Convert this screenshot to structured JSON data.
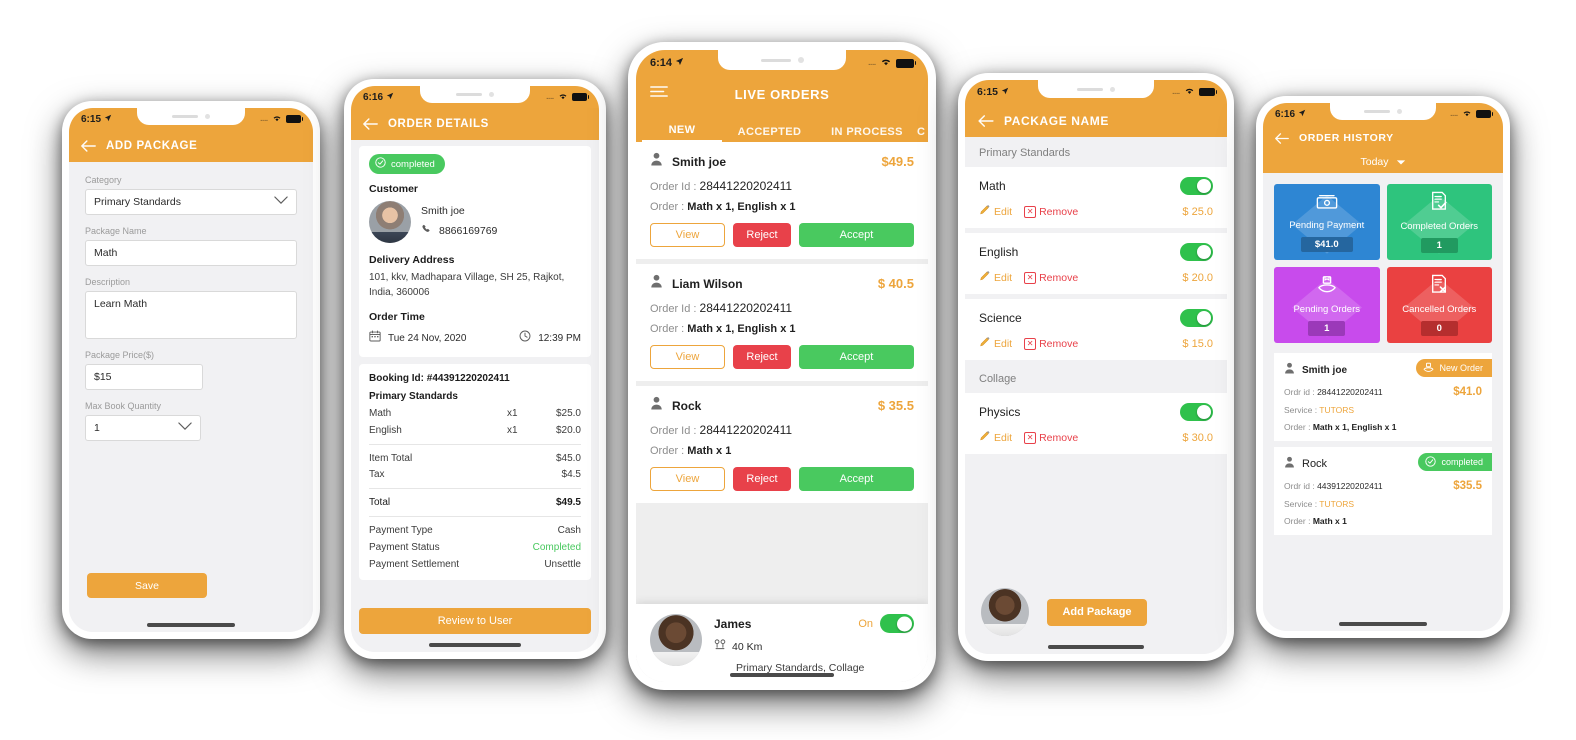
{
  "phones": {
    "add_package": {
      "status": {
        "time": "6:15",
        "location_icon": "location-arrow-icon",
        "signal_dots": "....",
        "wifi_icon": "wifi-icon",
        "battery_icon": "battery-icon"
      },
      "header": {
        "back_icon": "back-arrow-icon",
        "title": "ADD PACKAGE"
      },
      "fields": [
        {
          "label": "Category",
          "value": "Primary Standards",
          "type": "select",
          "icon": "chevron-down-icon"
        },
        {
          "label": "Package Name",
          "value": "Math",
          "type": "text"
        },
        {
          "label": "Description",
          "value": "Learn Math",
          "type": "textarea"
        },
        {
          "label": "Package Price($)",
          "value": "$15",
          "type": "text"
        },
        {
          "label": "Max Book Quantity",
          "value": "1",
          "type": "select",
          "icon": "chevron-down-icon"
        }
      ],
      "save_label": "Save"
    },
    "order_details": {
      "status": {
        "time": "6:16"
      },
      "header": {
        "back_icon": "back-arrow-icon",
        "title": "ORDER DETAILS"
      },
      "status_badge": {
        "label": "completed",
        "icon": "check-circle-icon",
        "color": "#49c95f"
      },
      "customer": {
        "section_title": "Customer",
        "name": "Smith joe",
        "phone_icon": "phone-icon",
        "phone": "8866169769",
        "avatar": "customer-avatar"
      },
      "delivery": {
        "section_title": "Delivery Address",
        "address": "101, kkv, Madhapara Village, SH 25, Rajkot, India, 360006"
      },
      "order_time": {
        "section_title": "Order Time",
        "calendar_icon": "calendar-icon",
        "date": "Tue 24 Nov, 2020",
        "clock_icon": "clock-icon",
        "time": "12:39 PM"
      },
      "booking": {
        "booking_id_label": "Booking Id: #44391220202411",
        "package_title": "Primary Standards",
        "items": [
          {
            "name": "Math",
            "qty": "x1",
            "price": "$25.0"
          },
          {
            "name": "English",
            "qty": "x1",
            "price": "$20.0"
          }
        ],
        "totals": [
          {
            "label": "Item Total",
            "value": "$45.0"
          },
          {
            "label": "Tax",
            "value": "$4.5"
          }
        ],
        "grand_total": {
          "label": "Total",
          "value": "$49.5"
        },
        "payment": [
          {
            "label": "Payment Type",
            "value": "Cash",
            "color": "#4a4a4a"
          },
          {
            "label": "Payment Status",
            "value": "Completed",
            "color": "#49c95f"
          },
          {
            "label": "Payment Settlement",
            "value": "Unsettle",
            "color": "#4a4a4a"
          }
        ]
      },
      "review_button": "Review to User"
    },
    "live_orders": {
      "status": {
        "time": "6:14"
      },
      "header": {
        "menu_icon": "hamburger-menu-icon",
        "title": "LIVE ORDERS"
      },
      "tabs": [
        {
          "label": "NEW",
          "active": true
        },
        {
          "label": "ACCEPTED",
          "active": false
        },
        {
          "label": "IN PROCESS",
          "active": false
        },
        {
          "label": "C",
          "active": false
        }
      ],
      "order_id_label": "Order Id :",
      "order_label": "Order :",
      "orders": [
        {
          "person_icon": "person-icon",
          "name": "Smith joe",
          "price": "$49.5",
          "order_id": "28441220202411",
          "items": "Math x 1, English x 1"
        },
        {
          "person_icon": "person-icon",
          "name": "Liam Wilson",
          "price": "$ 40.5",
          "order_id": "28441220202411",
          "items": "Math x 1, English x 1"
        },
        {
          "person_icon": "person-icon",
          "name": "Rock",
          "price": "$ 35.5",
          "order_id": "28441220202411",
          "items": "Math x 1"
        }
      ],
      "actions": {
        "view": "View",
        "reject": "Reject",
        "accept": "Accept"
      },
      "footer": {
        "name": "James",
        "distance_icon": "distance-pin-icon",
        "distance": "40 Km",
        "categories": "Primary Standards, Collage",
        "toggle_label": "On",
        "toggle_on": true
      }
    },
    "package_name": {
      "status": {
        "time": "6:15"
      },
      "header": {
        "back_icon": "back-arrow-icon",
        "title": "PACKAGE NAME"
      },
      "groups": [
        {
          "title": "Primary Standards",
          "items": [
            {
              "name": "Math",
              "price": "$ 25.0",
              "enabled": true,
              "edit": "Edit",
              "remove": "Remove",
              "edit_icon": "pencil-icon",
              "remove_icon": "x-box-icon"
            },
            {
              "name": "English",
              "price": "$ 20.0",
              "enabled": true,
              "edit": "Edit",
              "remove": "Remove",
              "edit_icon": "pencil-icon",
              "remove_icon": "x-box-icon"
            },
            {
              "name": "Science",
              "price": "$ 15.0",
              "enabled": true,
              "edit": "Edit",
              "remove": "Remove",
              "edit_icon": "pencil-icon",
              "remove_icon": "x-box-icon"
            }
          ]
        },
        {
          "title": "Collage",
          "items": [
            {
              "name": "Physics",
              "price": "$ 30.0",
              "enabled": true,
              "edit": "Edit",
              "remove": "Remove",
              "edit_icon": "pencil-icon",
              "remove_icon": "x-box-icon"
            }
          ]
        }
      ],
      "add_package_label": "Add Package",
      "avatar": "tutor-avatar"
    },
    "order_history": {
      "status": {
        "time": "6:16"
      },
      "header": {
        "back_icon": "back-arrow-icon",
        "title": "ORDER HISTORY",
        "filter_label": "Today",
        "filter_icon": "chevron-down-icon"
      },
      "tiles": [
        {
          "label": "Pending Payment",
          "value": "$41.0",
          "color": "#2e86d3",
          "value_bg": "#25669f",
          "icon": "money-cash-icon"
        },
        {
          "label": "Completed Orders",
          "value": "1",
          "color": "#2ec47d",
          "value_bg": "#219a60",
          "icon": "document-check-icon"
        },
        {
          "label": "Pending Orders",
          "value": "1",
          "color": "#c84bec",
          "value_bg": "#9b39b9",
          "icon": "hand-order-icon"
        },
        {
          "label": "Cancelled Orders",
          "value": "0",
          "color": "#ea4141",
          "value_bg": "#b52e2e",
          "icon": "document-x-icon"
        }
      ],
      "labels": {
        "order_id": "Ordr id :",
        "service": "Service :",
        "order": "Order :"
      },
      "history": [
        {
          "person_icon": "person-icon",
          "name": "Smith joe",
          "badge": {
            "label": "New Order",
            "type": "orange",
            "icon": "hand-order-icon"
          },
          "order_id": "28441220202411",
          "price": "$41.0",
          "service": "TUTORS",
          "items": "Math x 1, English x 1"
        },
        {
          "person_icon": "person-icon",
          "name": "Rock",
          "badge": {
            "label": "completed",
            "type": "green",
            "icon": "check-circle-icon"
          },
          "order_id": "44391220202411",
          "price": "$35.5",
          "service": "TUTORS",
          "items": "Math x 1"
        }
      ]
    }
  },
  "colors": {
    "brand_orange": "#eda53c",
    "green": "#49c95f",
    "red": "#e8414a",
    "page_bg": "#f1f1f3"
  }
}
